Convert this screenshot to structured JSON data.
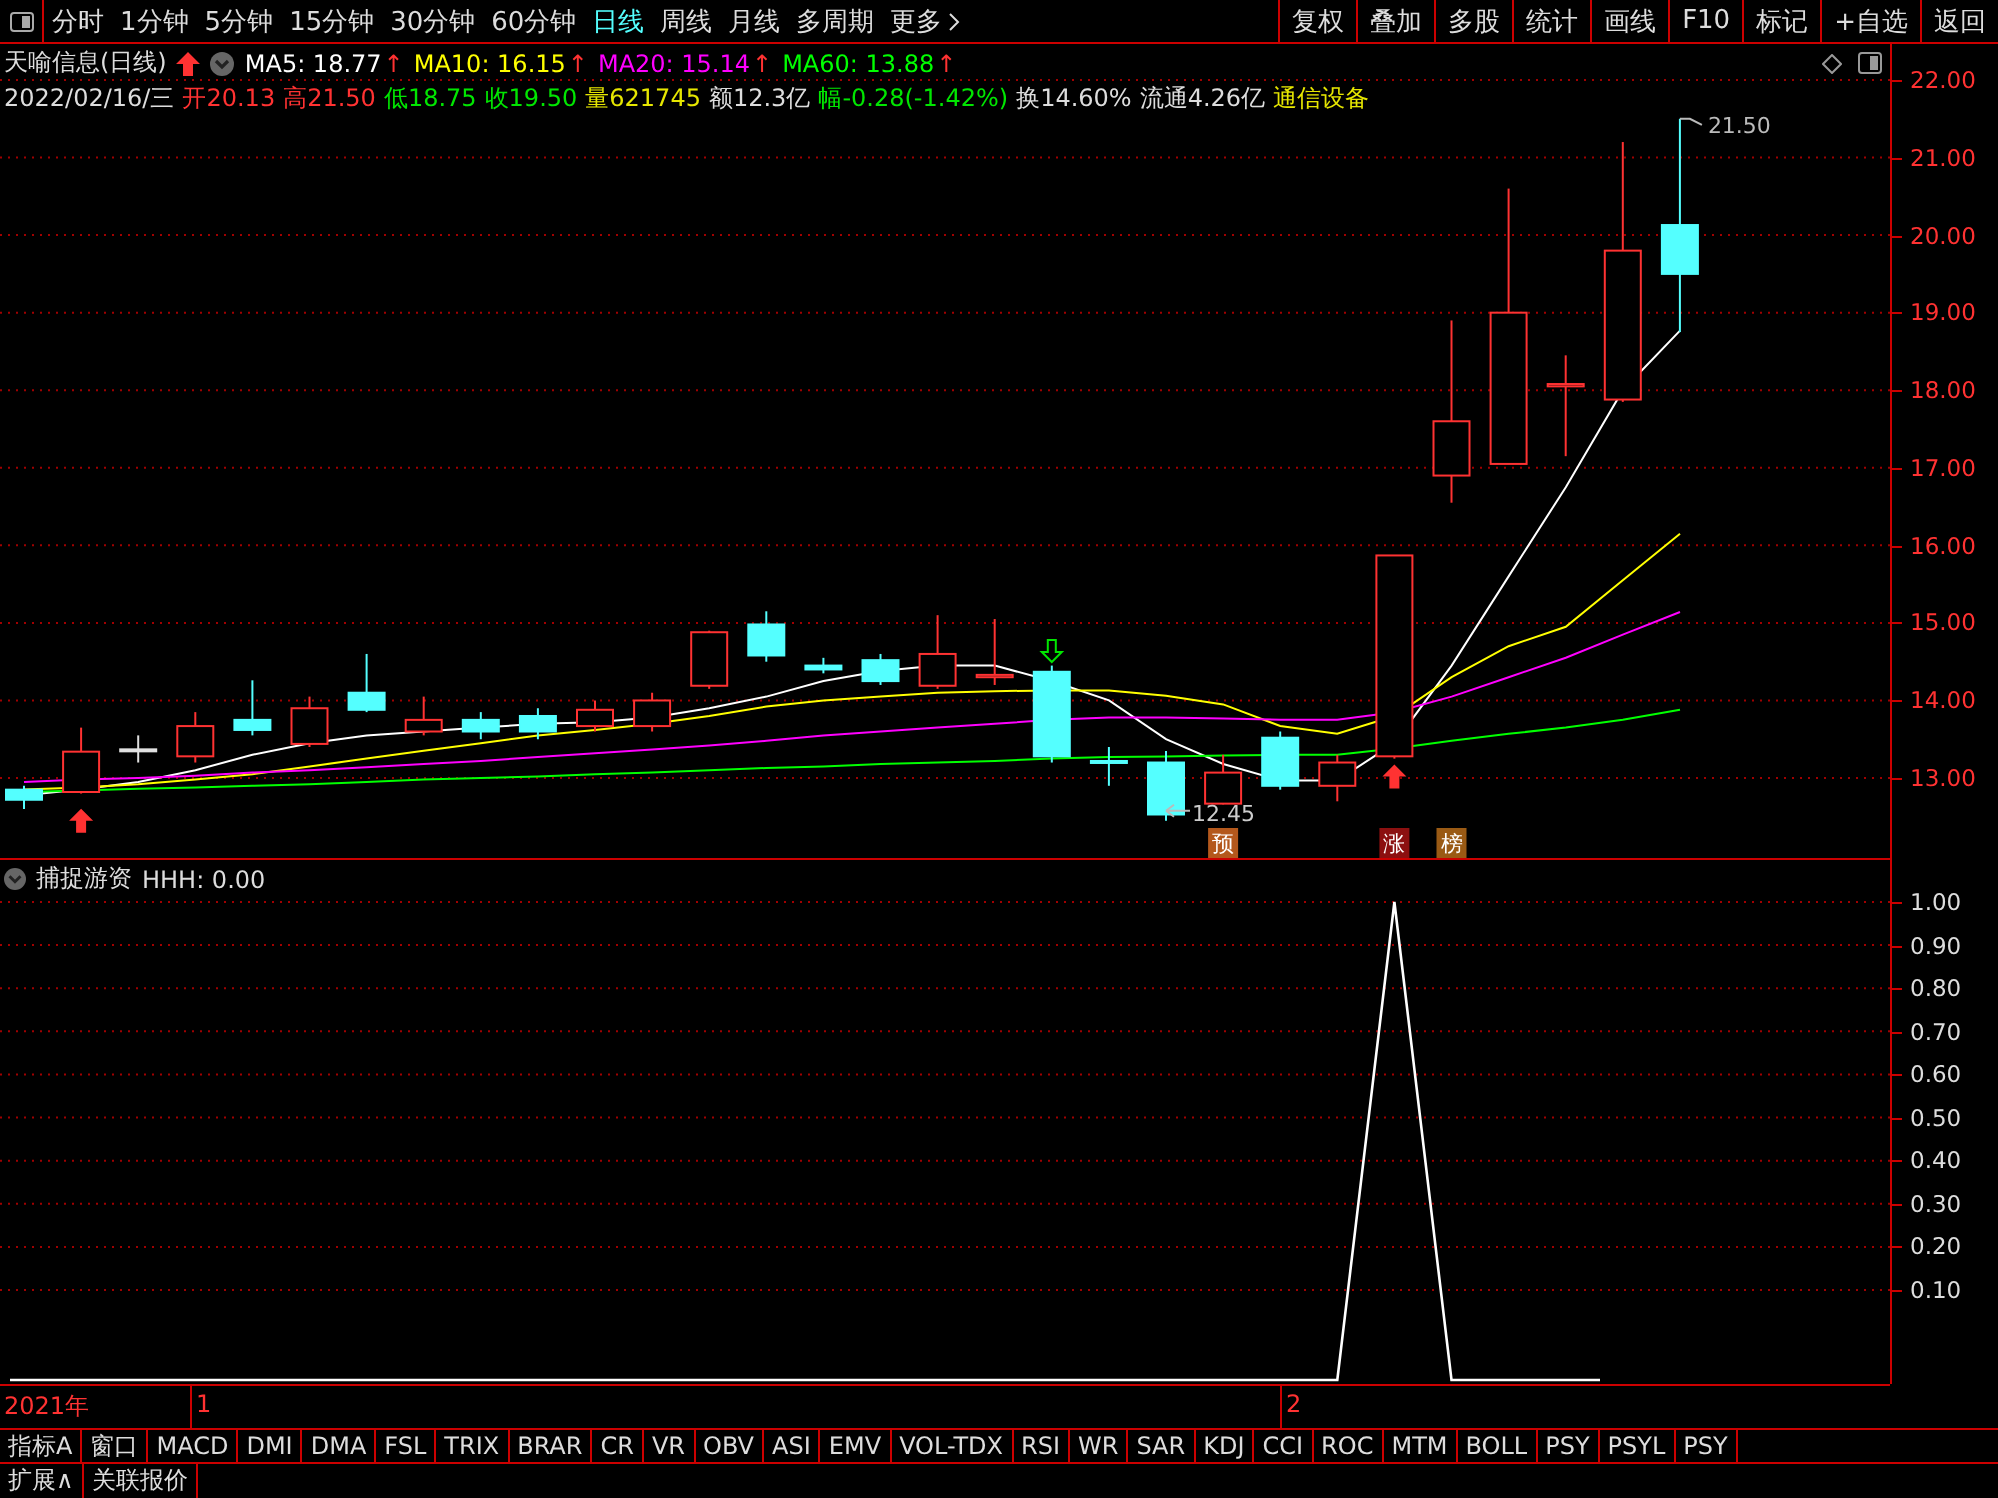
{
  "toolbar": {
    "periods": [
      {
        "label": "分时",
        "selected": false
      },
      {
        "label": "1分钟",
        "selected": false
      },
      {
        "label": "5分钟",
        "selected": false
      },
      {
        "label": "15分钟",
        "selected": false
      },
      {
        "label": "30分钟",
        "selected": false
      },
      {
        "label": "60分钟",
        "selected": false
      },
      {
        "label": "日线",
        "selected": true
      },
      {
        "label": "周线",
        "selected": false
      },
      {
        "label": "月线",
        "selected": false
      },
      {
        "label": "多周期",
        "selected": false
      }
    ],
    "more": {
      "label": "更多"
    },
    "actions": [
      "复权",
      "叠加",
      "多股",
      "统计",
      "画线",
      "F10",
      "标记",
      "+自选",
      "返回"
    ]
  },
  "price_panel": {
    "title": "天喻信息(日线)",
    "ma_readouts": [
      {
        "text": "MA5: 18.77",
        "color": "#ffffff",
        "arrow": "↑"
      },
      {
        "text": "MA10: 16.15",
        "color": "#ffff00",
        "arrow": "↑"
      },
      {
        "text": "MA20: 15.14",
        "color": "#ff00ff",
        "arrow": "↑"
      },
      {
        "text": "MA60: 13.88",
        "color": "#00ff00",
        "arrow": "↑"
      }
    ],
    "quote": [
      {
        "text": "2022/02/16/三",
        "color": "#dddddd"
      },
      {
        "text": "开20.13",
        "color": "#ff3232"
      },
      {
        "text": "高21.50",
        "color": "#ff3232"
      },
      {
        "text": "低18.75",
        "color": "#00e600"
      },
      {
        "text": "收19.50",
        "color": "#00e600"
      },
      {
        "text": "量621745",
        "color": "#e6e600"
      },
      {
        "text": "额12.3亿",
        "color": "#dddddd"
      },
      {
        "text": "幅-0.28(-1.42%)",
        "color": "#00e600"
      },
      {
        "text": "换14.60%",
        "color": "#dddddd"
      },
      {
        "text": "流通4.26亿",
        "color": "#dddddd"
      },
      {
        "text": "通信设备",
        "color": "#e6e600"
      }
    ],
    "high_label": "21.50",
    "low_label": "12.45",
    "signal_tags": [
      {
        "text": "预",
        "color": "#b4581c"
      },
      {
        "text": "涨",
        "color": "#8c1010"
      },
      {
        "text": "榜",
        "color": "#9a5a14"
      }
    ],
    "axis_labels": [
      "22.00",
      "21.00",
      "20.00",
      "19.00",
      "18.00",
      "17.00",
      "16.00",
      "15.00",
      "14.00",
      "13.00"
    ]
  },
  "indicator_panel": {
    "name": "捕捉游资",
    "readout": "HHH: 0.00",
    "axis_labels": [
      "1.00",
      "0.90",
      "0.80",
      "0.70",
      "0.60",
      "0.50",
      "0.40",
      "0.30",
      "0.20",
      "0.10"
    ]
  },
  "date_axis": [
    "2021年",
    "1",
    "2"
  ],
  "indicator_tabs": [
    "指标A",
    "窗口",
    "MACD",
    "DMI",
    "DMA",
    "FSL",
    "TRIX",
    "BRAR",
    "CR",
    "VR",
    "OBV",
    "ASI",
    "EMV",
    "VOL-TDX",
    "RSI",
    "WR",
    "SAR",
    "KDJ",
    "CCI",
    "ROC",
    "MTM",
    "BOLL",
    "PSY",
    "PSYL",
    "PSY"
  ],
  "bottom_bar": [
    "扩展∧",
    "关联报价"
  ]
}
